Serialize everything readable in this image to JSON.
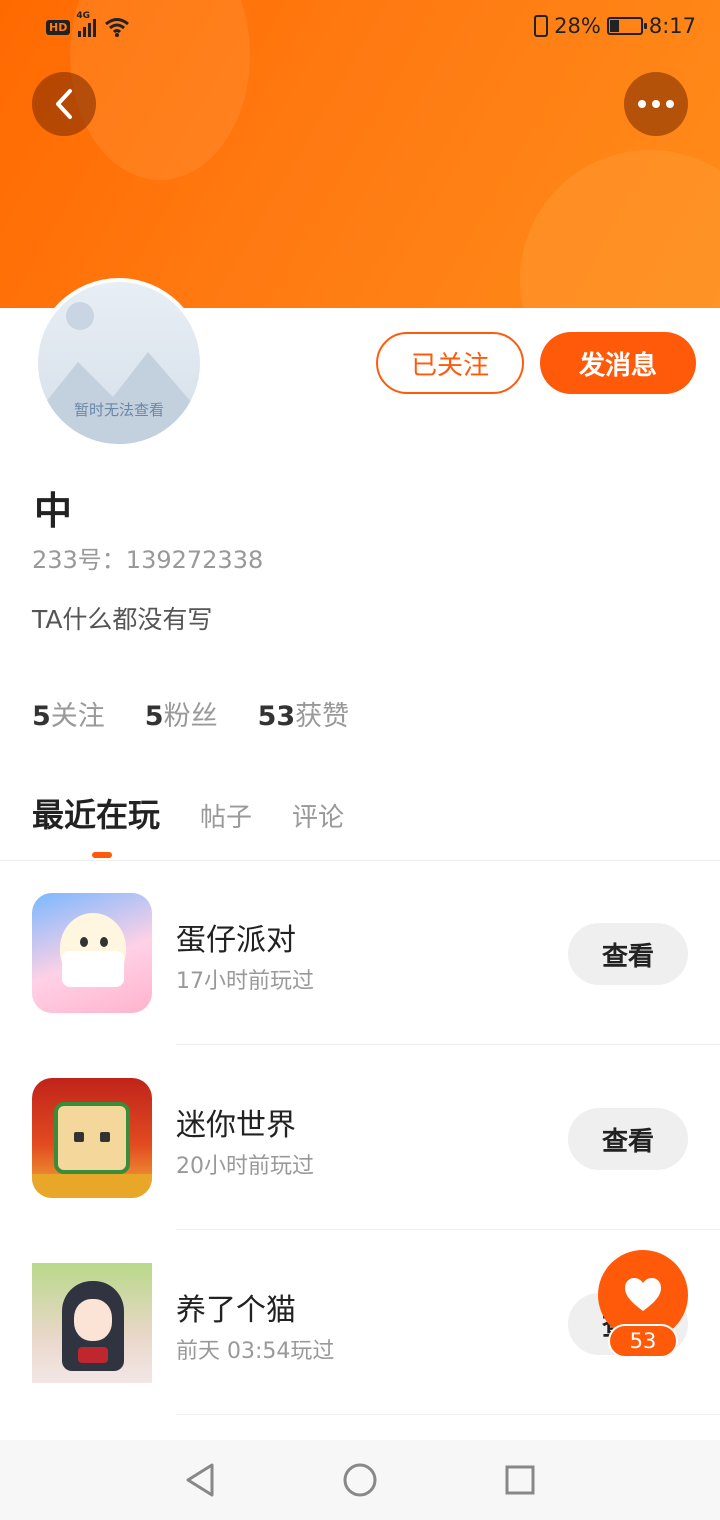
{
  "status_bar": {
    "hd": "HD",
    "network": "4G",
    "battery_percent": "28%",
    "battery_level": 0.28,
    "time": "8:17"
  },
  "header": {
    "back_icon": "chevron-left-icon",
    "more_icon": "more-dots-icon",
    "gradient_colors": [
      "#ff6a00",
      "#ff8c1a"
    ]
  },
  "profile": {
    "avatar_placeholder": "暂时无法查看",
    "follow_label": "已关注",
    "message_label": "发消息",
    "username": "中",
    "user_id": "233号：139272338",
    "bio": "TA什么都没有写",
    "stats": {
      "following_count": "5",
      "following_label": "关注",
      "fans_count": "5",
      "fans_label": "粉丝",
      "likes_count": "53",
      "likes_label": "获赞"
    }
  },
  "tabs": [
    {
      "label": "最近在玩",
      "active": true
    },
    {
      "label": "帖子",
      "active": false
    },
    {
      "label": "评论",
      "active": false
    }
  ],
  "games": [
    {
      "name": "蛋仔派对",
      "time": "17小时前玩过",
      "button": "查看"
    },
    {
      "name": "迷你世界",
      "time": "20小时前玩过",
      "button": "查看"
    },
    {
      "name": "养了个猫",
      "time": "前天 03:54玩过",
      "button": "查看"
    }
  ],
  "like_fab": {
    "icon": "heart-icon",
    "count": "53"
  },
  "nav_bar": {
    "back_icon": "triangle-back-icon",
    "home_icon": "circle-home-icon",
    "recents_icon": "square-recents-icon"
  },
  "colors": {
    "accent": "#ff5a0a",
    "button_gray": "#efefef"
  }
}
